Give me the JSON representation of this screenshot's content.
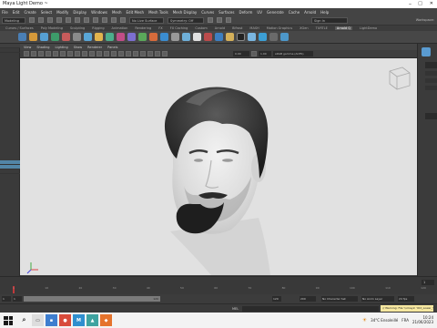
{
  "window": {
    "title": "Maya Light Demo ~"
  },
  "menubar": {
    "items": [
      "File",
      "Edit",
      "Create",
      "Select",
      "Modify",
      "Display",
      "Windows",
      "Mesh",
      "Edit Mesh",
      "Mesh Tools",
      "Mesh Display",
      "Curves",
      "Surfaces",
      "Deform",
      "UV",
      "Generate",
      "Cache",
      "Arnold",
      "Help"
    ]
  },
  "statusline": {
    "mode": "Modeling",
    "no_live_surface": "No Live Surface",
    "symmetry": "Symmetry: Off",
    "sign_in": "Sign In",
    "workspace": "Workspace:"
  },
  "shelf": {
    "tabs": [
      "Curves / Surfaces",
      "Poly Modeling",
      "Sculpting",
      "Rigging",
      "Animation",
      "Rendering",
      "FX",
      "FX Caching",
      "Custom",
      "Arnold",
      "Bifrost",
      "MASH",
      "Motion Graphics",
      "XGen",
      "TURTLE",
      "Arnold Q",
      "LightDemo"
    ],
    "active_tab": "Arnold Q"
  },
  "viewport_menu": {
    "items": [
      "View",
      "Shading",
      "Lighting",
      "Show",
      "Renderer",
      "Panels"
    ]
  },
  "viewport_toolbar": {
    "value_a": "0.00",
    "value_b": "1.00",
    "color_space": "sRGB gamma (ACES)"
  },
  "timeline": {
    "ticks": [
      "1",
      "5",
      "10",
      "15",
      "20",
      "25",
      "30",
      "35",
      "40",
      "45",
      "50",
      "55",
      "60",
      "65",
      "70",
      "75",
      "80",
      "85",
      "90",
      "95",
      "100",
      "105",
      "110",
      "115",
      "120"
    ],
    "current_frame": "1"
  },
  "range": {
    "start": "1",
    "start_in": "1",
    "end_in": "120",
    "end_out": "120",
    "end": "200",
    "char_set": "No Character Set",
    "anim_layer": "No Anim Layer",
    "fps": "24 fps"
  },
  "cmdline": {
    "label": "MEL",
    "warning": "// Warning: File '\\vmaya' 'Old_Lower_Teeth_Shaded' could not be found."
  },
  "taskbar": {
    "weather": "34°C  Ensoleillé",
    "time": "10:24",
    "date": "21/06/2023",
    "lang": "FRA"
  },
  "colors": {
    "maya_bg": "#444444",
    "viewport_bg": "#e1e1e1",
    "accent": "#5285a6",
    "warning": "#f7e8a0",
    "timeline_frame": "#c1393b"
  }
}
